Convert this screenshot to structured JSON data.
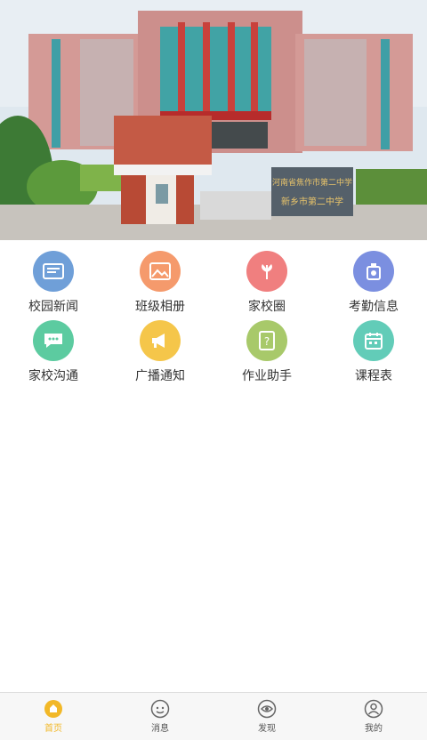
{
  "banner": {
    "image_name": "school-building-photo",
    "sign_line1": "河南省焦作市第二中学",
    "sign_line2": "新乡市第二中学"
  },
  "menu": [
    {
      "label": "校园新闻",
      "icon": "newspaper-icon",
      "color": "#6f9fd8"
    },
    {
      "label": "班级相册",
      "icon": "photo-icon",
      "color": "#f59a6c"
    },
    {
      "label": "家校圈",
      "icon": "leaf-icon",
      "color": "#f07f7f"
    },
    {
      "label": "考勤信息",
      "icon": "attendance-icon",
      "color": "#7b8fe0"
    },
    {
      "label": "家校沟通",
      "icon": "chat-icon",
      "color": "#5ccba0"
    },
    {
      "label": "广播通知",
      "icon": "megaphone-icon",
      "color": "#f5c64a"
    },
    {
      "label": "作业助手",
      "icon": "homework-icon",
      "color": "#a8c96a"
    },
    {
      "label": "课程表",
      "icon": "calendar-icon",
      "color": "#62ccb8"
    }
  ],
  "tabbar": {
    "active_color": "#f2b827",
    "items": [
      {
        "label": "首页",
        "icon": "home-icon"
      },
      {
        "label": "消息",
        "icon": "message-icon"
      },
      {
        "label": "发现",
        "icon": "discover-icon"
      },
      {
        "label": "我的",
        "icon": "profile-icon"
      }
    ]
  }
}
